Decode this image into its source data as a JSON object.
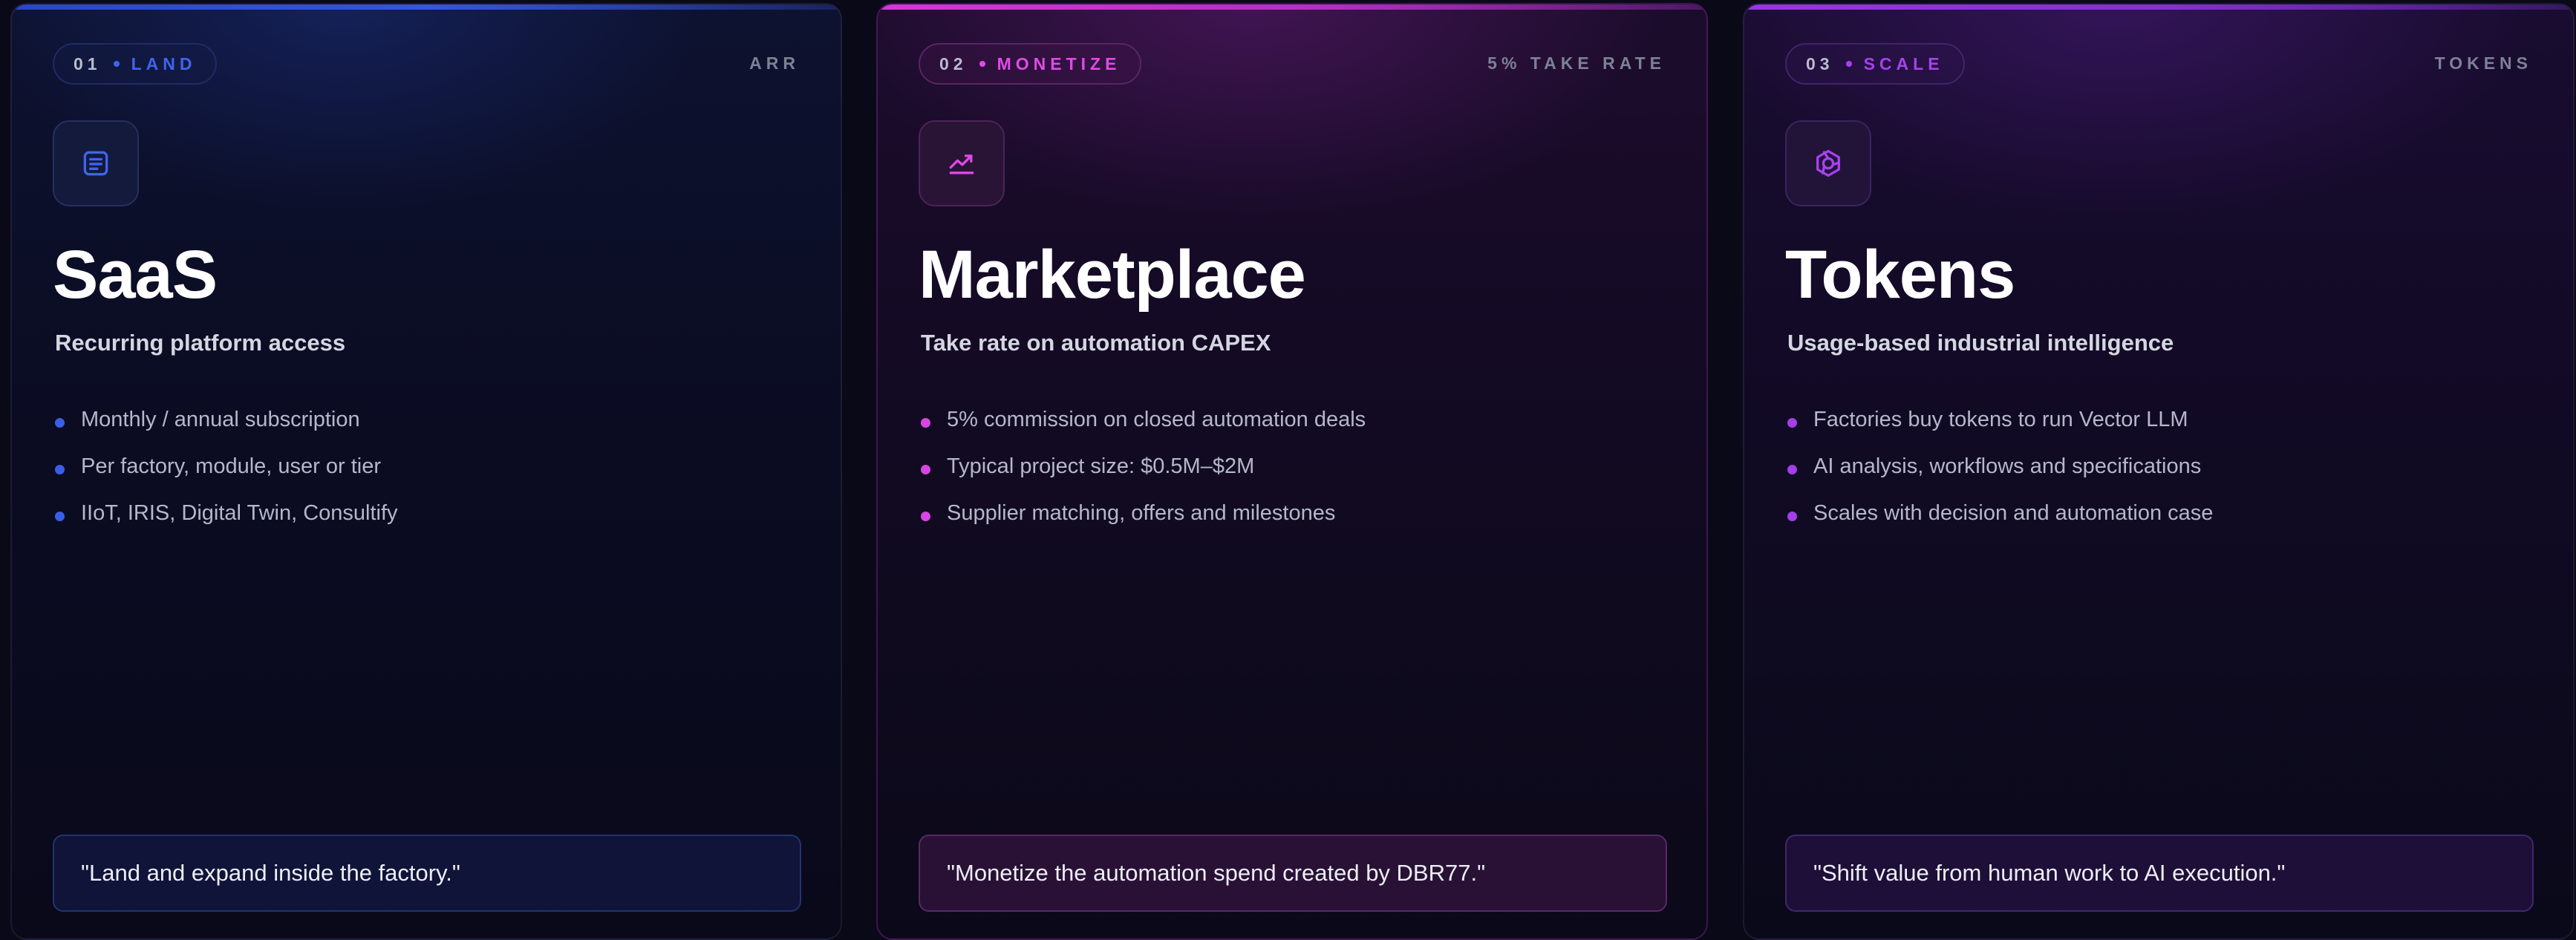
{
  "cards": [
    {
      "badge_num": "01",
      "badge_label": "LAND",
      "corner_label": "ARR",
      "icon": "document-icon",
      "title": "SaaS",
      "subtitle": "Recurring platform access",
      "bullets": [
        "Monthly / annual subscription",
        "Per factory, module, user or tier",
        "IIoT, IRIS, Digital Twin, Consultify"
      ],
      "quote": "\"Land and expand inside the factory.\"",
      "accent": "#3f64ee"
    },
    {
      "badge_num": "02",
      "badge_label": "MONETIZE",
      "corner_label": "5% TAKE RATE",
      "icon": "trending-up-icon",
      "title": "Marketplace",
      "subtitle": "Take rate on automation CAPEX",
      "bullets": [
        "5% commission on closed automation deals",
        "Typical project size: $0.5M–$2M",
        "Supplier matching, offers and milestones"
      ],
      "quote": "\"Monetize the automation spend created by DBR77.\"",
      "accent": "#e04ae6"
    },
    {
      "badge_num": "03",
      "badge_label": "SCALE",
      "corner_label": "TOKENS",
      "icon": "token-hexagon-icon",
      "title": "Tokens",
      "subtitle": "Usage-based industrial intelligence",
      "bullets": [
        "Factories buy tokens to run Vector LLM",
        "AI analysis, workflows and specifications",
        "Scales with decision and automation case"
      ],
      "quote": "\"Shift value from human work to AI execution.\"",
      "accent": "#a542ee"
    }
  ]
}
